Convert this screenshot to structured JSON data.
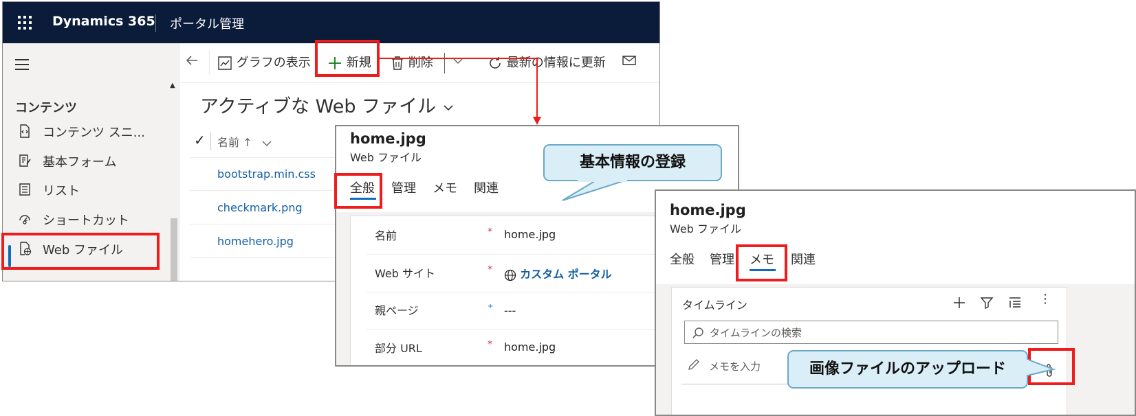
{
  "topbar": {
    "brand": "Dynamics 365",
    "app_name": "ポータル管理"
  },
  "sidebar": {
    "heading": "コンテンツ",
    "items": [
      {
        "label": "コンテンツ スニ...",
        "icon": "code-document-icon"
      },
      {
        "label": "基本フォーム",
        "icon": "form-icon"
      },
      {
        "label": "リスト",
        "icon": "list-icon"
      },
      {
        "label": "ショートカット",
        "icon": "shortcut-icon"
      },
      {
        "label": "Web ファイル",
        "icon": "web-file-icon",
        "selected": true
      }
    ]
  },
  "command_bar": {
    "show_chart": "グラフの表示",
    "new": "新規",
    "delete": "削除",
    "refresh": "最新の情報に更新"
  },
  "list": {
    "title": "アクティブな Web ファイル",
    "column_name": "名前 ↑",
    "rows": [
      "bootstrap.min.css",
      "checkmark.png",
      "homehero.jpg"
    ]
  },
  "form_general": {
    "title": "home.jpg",
    "subtitle": "Web ファイル",
    "tabs": [
      "全般",
      "管理",
      "メモ",
      "関連"
    ],
    "fields": [
      {
        "label": "名前",
        "marker": "*",
        "value": "home.jpg"
      },
      {
        "label": "Web サイト",
        "marker": "*",
        "value": "カスタム ポータル"
      },
      {
        "label": "親ページ",
        "marker": "+",
        "value": "---"
      },
      {
        "label": "部分 URL",
        "marker": "*",
        "value": "home.jpg"
      }
    ]
  },
  "form_notes": {
    "title": "home.jpg",
    "subtitle": "Web ファイル",
    "tabs": [
      "全般",
      "管理",
      "メモ",
      "関連"
    ],
    "timeline_label": "タイムライン",
    "search_placeholder": "タイムラインの検索",
    "note_placeholder": "メモを入力"
  },
  "callouts": {
    "basic_info": "基本情報の登録",
    "upload": "画像ファイルのアップロード"
  },
  "colors": {
    "accent": "#0f6cbd",
    "highlight": "#ee1c1c",
    "topbar": "#0b1b3a",
    "callout": "#daeef7"
  }
}
